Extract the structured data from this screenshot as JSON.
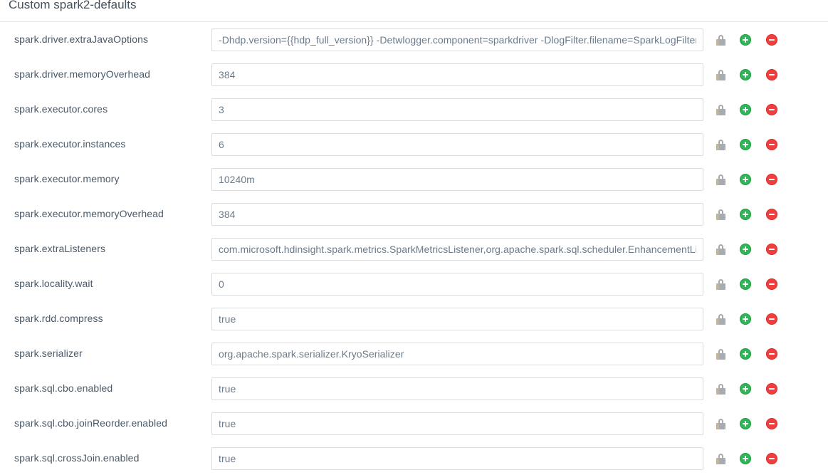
{
  "section": {
    "title": "Custom spark2-defaults"
  },
  "icons": {
    "lock": "lock-icon",
    "add": "add-property-icon",
    "remove": "remove-property-icon"
  },
  "colors": {
    "add_green": "#2fb457",
    "remove_red": "#ef3e3e",
    "lock_gray": "#a7acb2",
    "label_text": "#4a5968",
    "input_text": "#6c7b8a",
    "input_border": "#d8dce0",
    "divider": "#e4e6e8"
  },
  "properties": [
    {
      "name": "spark.driver.extraJavaOptions",
      "value": "-Dhdp.version={{hdp_full_version}} -Detwlogger.component=sparkdriver -DlogFilter.filename=SparkLogFilters.xml"
    },
    {
      "name": "spark.driver.memoryOverhead",
      "value": "384"
    },
    {
      "name": "spark.executor.cores",
      "value": "3"
    },
    {
      "name": "spark.executor.instances",
      "value": "6"
    },
    {
      "name": "spark.executor.memory",
      "value": "10240m"
    },
    {
      "name": "spark.executor.memoryOverhead",
      "value": "384"
    },
    {
      "name": "spark.extraListeners",
      "value": "com.microsoft.hdinsight.spark.metrics.SparkMetricsListener,org.apache.spark.sql.scheduler.EnhancementListener"
    },
    {
      "name": "spark.locality.wait",
      "value": "0"
    },
    {
      "name": "spark.rdd.compress",
      "value": "true"
    },
    {
      "name": "spark.serializer",
      "value": "org.apache.spark.serializer.KryoSerializer"
    },
    {
      "name": "spark.sql.cbo.enabled",
      "value": "true"
    },
    {
      "name": "spark.sql.cbo.joinReorder.enabled",
      "value": "true"
    },
    {
      "name": "spark.sql.crossJoin.enabled",
      "value": "true"
    }
  ]
}
